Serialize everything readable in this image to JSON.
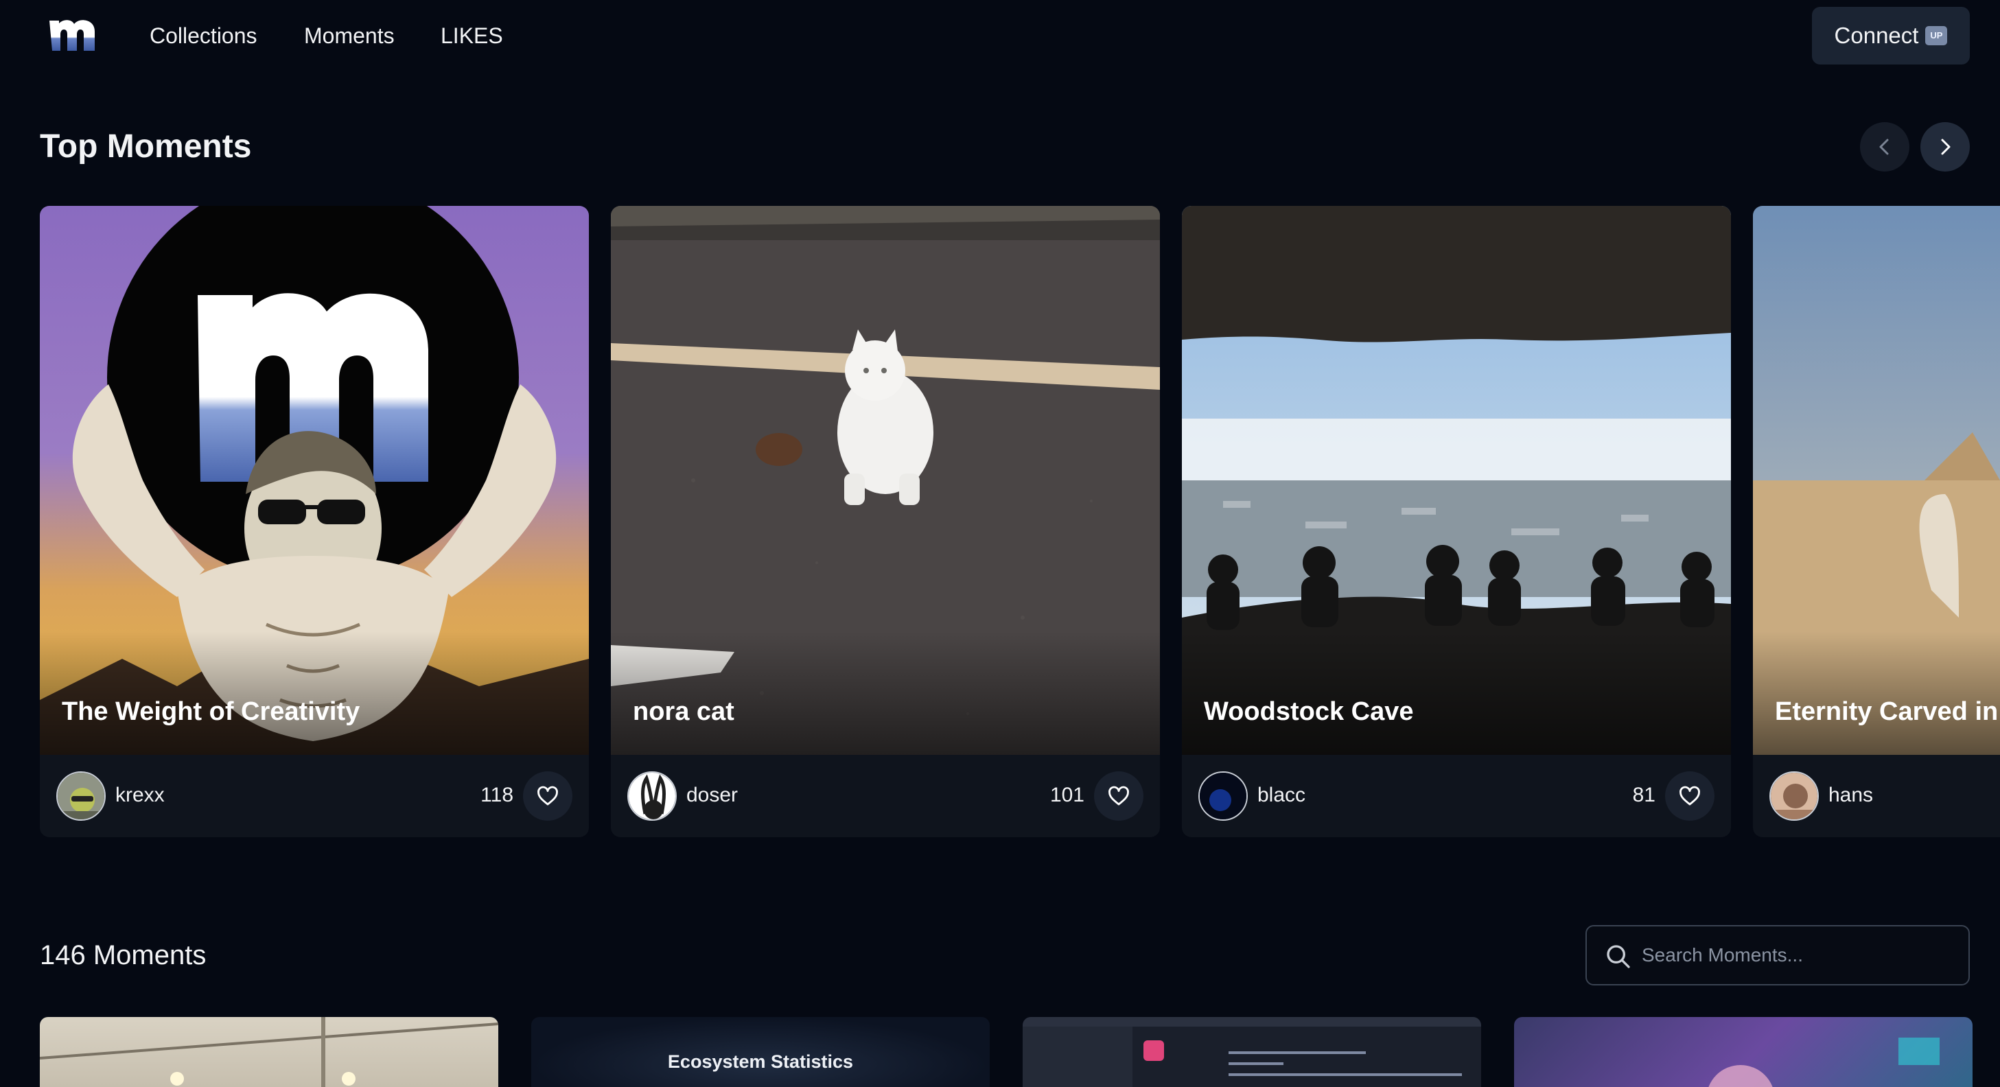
{
  "nav": {
    "logo_alt": "m",
    "links": [
      "Collections",
      "Moments",
      "LIKES"
    ],
    "connect_label": "Connect",
    "connect_badge": "UP"
  },
  "top_moments": {
    "title": "Top Moments",
    "cards": [
      {
        "title": "The Weight of Creativity",
        "user": "krexx",
        "likes": "118"
      },
      {
        "title": "nora cat",
        "user": "doser",
        "likes": "101"
      },
      {
        "title": "Woodstock Cave",
        "user": "blacc",
        "likes": "81"
      },
      {
        "title": "Eternity Carved in",
        "user": "hans",
        "likes": ""
      }
    ]
  },
  "moments": {
    "count_label": "146 Moments",
    "search_placeholder": "Search Moments...",
    "grid": [
      {
        "label": ""
      },
      {
        "label": "Ecosystem Statistics"
      },
      {
        "label": ""
      },
      {
        "label": ""
      }
    ]
  },
  "colors": {
    "background": "#050913",
    "card": "#0f141d",
    "button": "#1b2433",
    "accent_blue": "#5b74b8"
  }
}
